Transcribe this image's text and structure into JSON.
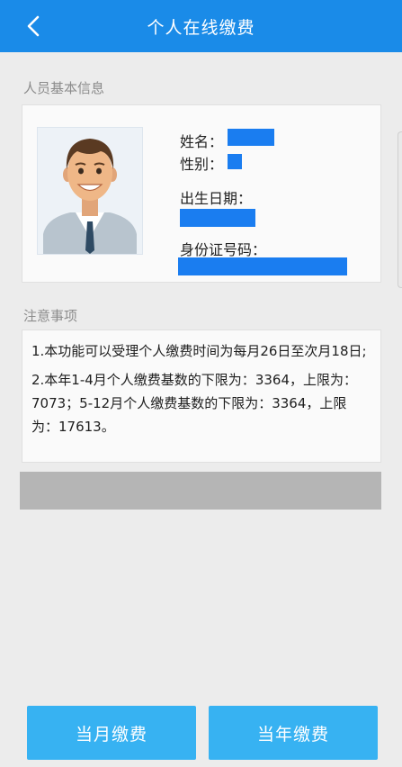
{
  "header": {
    "title": "个人在线缴费",
    "back_icon": "chevron-left-icon"
  },
  "basic_info": {
    "section_label": "人员基本信息",
    "name_label": "姓名：",
    "gender_label": "性别：",
    "birth_label": "出生日期：",
    "id_label": "身份证号码：",
    "redaction_color": "#1a7df0",
    "photo_icon": "user-avatar-icon"
  },
  "notice": {
    "section_label": "注意事项",
    "items": [
      "1.本功能可以受理个人缴费时间为每月26日至次月18日;",
      "2.本年1-4月个人缴费基数的下限为：3364，上限为：7073；5-12月个人缴费基数的下限为：3364，上限为：17613。"
    ]
  },
  "buttons": {
    "monthly": "当月缴费",
    "yearly": "当年缴费"
  },
  "colors": {
    "header_bg": "#1a8be8",
    "button_bg": "#37b2f2",
    "page_bg": "#ececec"
  }
}
